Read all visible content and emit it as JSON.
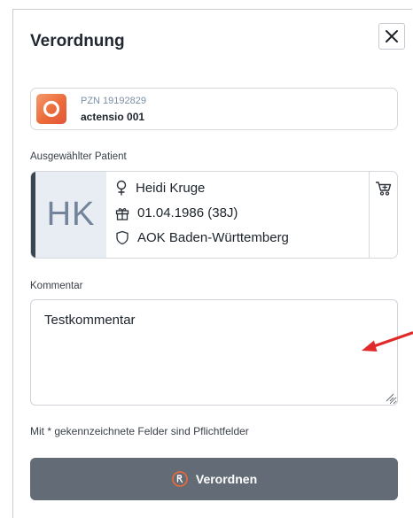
{
  "dialog": {
    "title": "Verordnung",
    "close_icon": "close-icon"
  },
  "product": {
    "pzn": "PZN 19192829",
    "name": "actensio 001",
    "logo_icon": "actensio-logo"
  },
  "patient": {
    "section_label": "Ausgewählter Patient",
    "initials": "HK",
    "name": "Heidi Kruge",
    "birthdate": "01.04.1986 (38J)",
    "insurance": "AOK Baden-Württemberg",
    "icons": [
      "female-icon",
      "gift-icon",
      "shield-icon",
      "cart-icon"
    ]
  },
  "comment": {
    "label": "Kommentar",
    "value": "Testkommentar"
  },
  "required_note": "Mit * gekennzeichnete Felder sind Pflichtfelder",
  "submit": {
    "label": "Verordnen",
    "icon": "prescription-icon"
  },
  "colors": {
    "accent": "#e36a3d",
    "button": "#636c76",
    "annotation_arrow": "#e02a2a"
  }
}
